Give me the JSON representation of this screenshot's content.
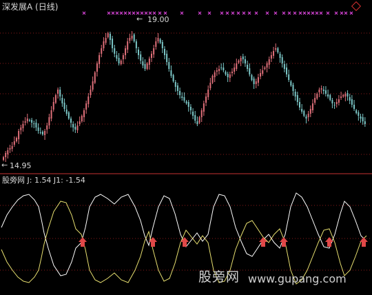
{
  "header": {
    "title": "深发展A (日线)",
    "indicator_line": "股旁网  J: 1.54  J1: -1.54"
  },
  "price_panel": {
    "max_price": "19.00",
    "min_price": "14.95",
    "max_arrow": "←",
    "min_arrow": "←"
  },
  "watermark": {
    "brand": "股旁网",
    "url": "www.gupang.com"
  },
  "colors": {
    "up": "#e0707a",
    "down": "#7cc8c8",
    "grid": "#8b1a1a",
    "separator": "#c83232",
    "signal_cross": "#d844d8",
    "line_j": "#ffffff",
    "line_j1": "#e8e070",
    "buy_arrow": "#e04848"
  },
  "icons": {
    "corner": "diamond-icon",
    "buy": "red-up-arrow-icon",
    "signal": "magenta-cross-icon"
  }
}
